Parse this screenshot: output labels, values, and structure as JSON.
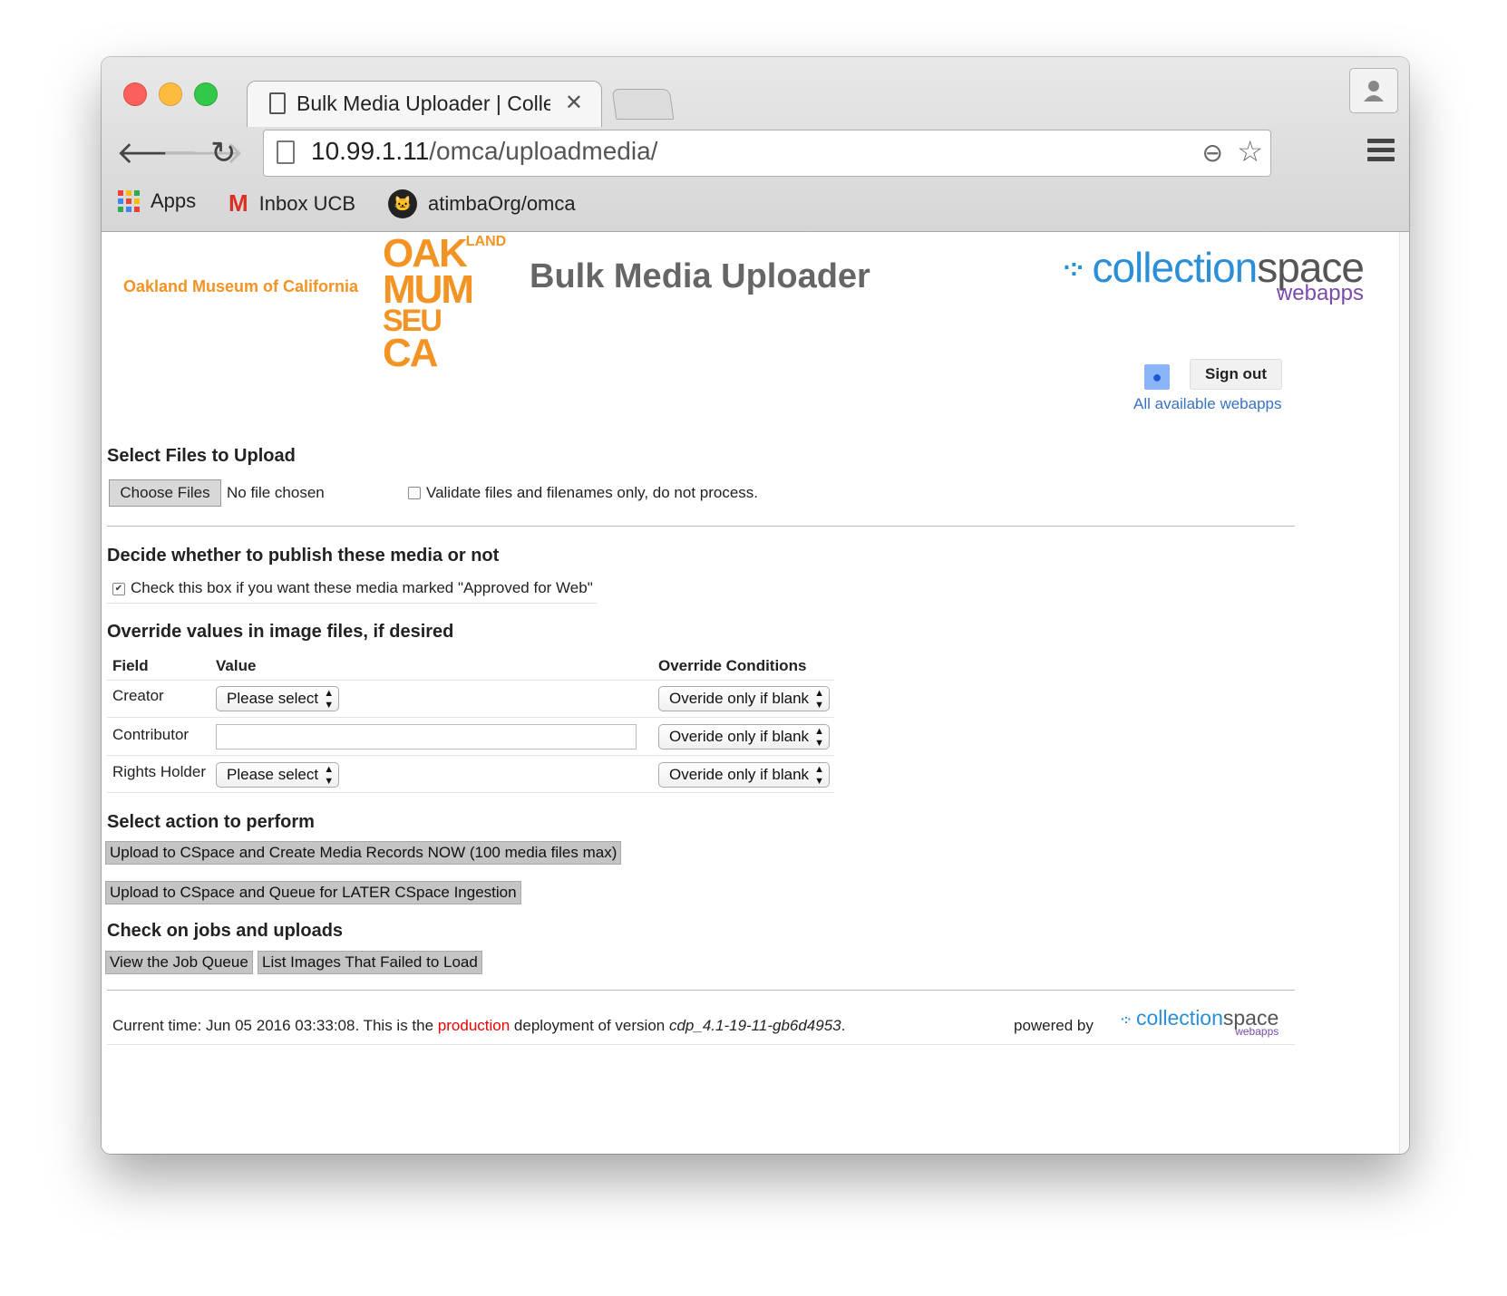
{
  "browser": {
    "tab_title": "Bulk Media Uploader | Colle",
    "tab_close": "✕",
    "url_host": "10.99.1.11",
    "url_path": "/omca/uploadmedia/",
    "bookmarks": [
      {
        "label": "Apps"
      },
      {
        "label": "Inbox UCB"
      },
      {
        "label": "atimbaOrg/omca"
      }
    ]
  },
  "header": {
    "museum_name": "Oakland Museum of California",
    "logo_lines": [
      "OAK",
      "LAND",
      "MUM",
      "SEU",
      "CA"
    ],
    "title": "Bulk Media Uploader",
    "cs_brand": "collection",
    "cs_brand2": "space",
    "cs_sub": "webapps",
    "sign_out": "Sign out",
    "all_webapps": "All available webapps"
  },
  "select_files": {
    "heading": "Select Files to Upload",
    "choose_label": "Choose Files",
    "no_file": "No file chosen",
    "validate_label": "Validate files and filenames only, do not process.",
    "validate_checked": false
  },
  "publish": {
    "heading": "Decide whether to publish these media or not",
    "approve_label": "Check this box if you want these media marked \"Approved for Web\"",
    "approve_checked": true
  },
  "override": {
    "heading": "Override values in image files, if desired",
    "columns": [
      "Field",
      "Value",
      "Override Conditions"
    ],
    "rows": [
      {
        "field": "Creator",
        "value": "Please select",
        "condition": "Overide only if blank"
      },
      {
        "field": "Contributor",
        "value": "",
        "condition": "Overide only if blank"
      },
      {
        "field": "Rights Holder",
        "value": "Please select",
        "condition": "Overide only if blank"
      }
    ]
  },
  "actions": {
    "heading": "Select action to perform",
    "upload_now": "Upload to CSpace and Create Media Records NOW (100 media files max)",
    "upload_later": "Upload to CSpace and Queue for LATER CSpace Ingestion"
  },
  "jobs": {
    "heading": "Check on jobs and uploads",
    "view_queue": "View the Job Queue",
    "list_failed": "List Images That Failed to Load"
  },
  "footer": {
    "time_prefix": "Current time: Jun 05 2016 03:33:08. This is the ",
    "env": "production",
    "mid": " deployment of version ",
    "version": "cdp_4.1-19-11-gb6d4953",
    "end": ".",
    "powered_by": "powered by"
  },
  "colors": {
    "accent_orange": "#f39324",
    "cs_blue": "#2b8fd8",
    "cs_purple": "#7b4bab",
    "env_red": "#ee0000"
  }
}
